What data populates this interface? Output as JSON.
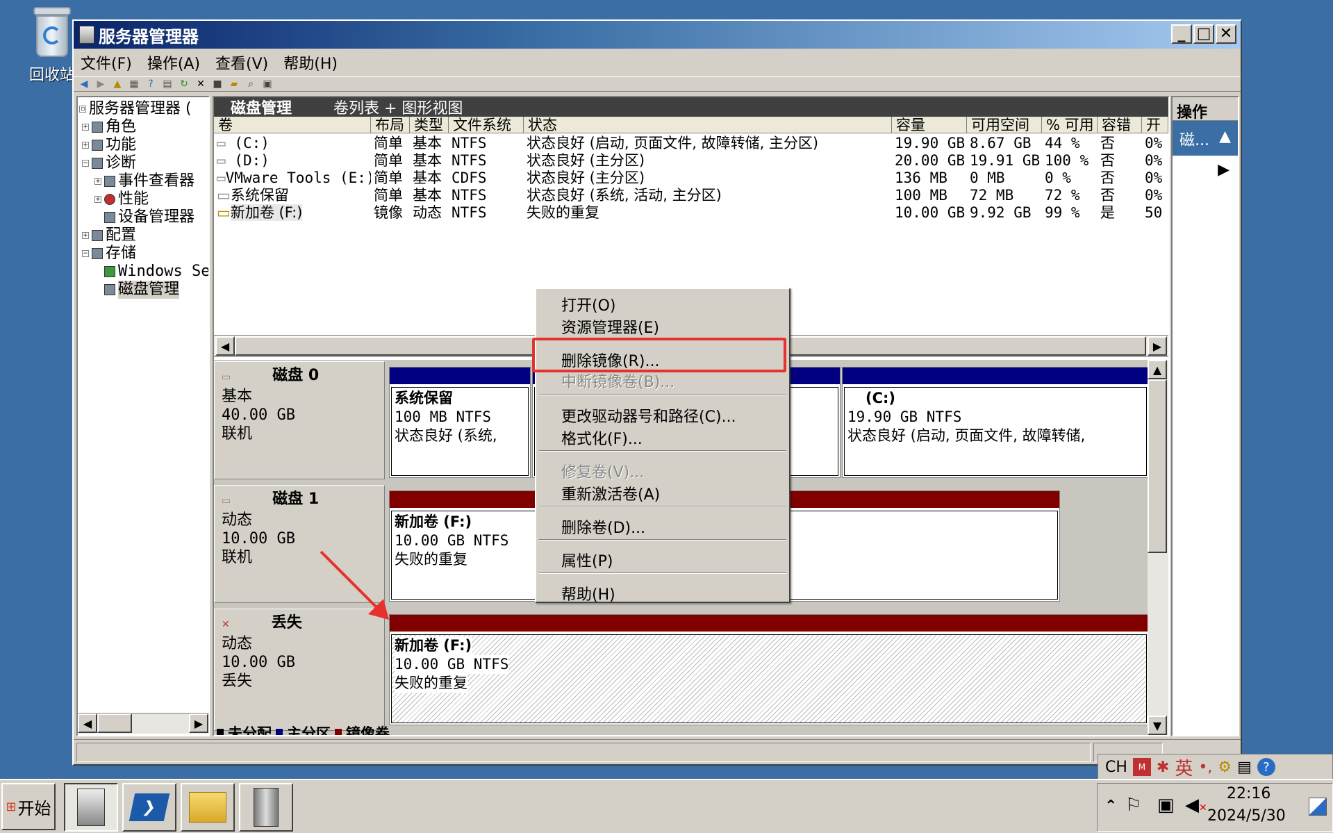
{
  "desktop": {
    "recycle_bin_label": "回收站"
  },
  "window": {
    "title": "服务器管理器",
    "controls": {
      "minimize": "_",
      "maximize": "□",
      "close": "✕"
    },
    "menu": [
      "文件(F)",
      "操作(A)",
      "查看(V)",
      "帮助(H)"
    ]
  },
  "tree": {
    "items": [
      {
        "label": "服务器管理器 (",
        "level": 0
      },
      {
        "label": "角色",
        "level": 1
      },
      {
        "label": "功能",
        "level": 1
      },
      {
        "label": "诊断",
        "level": 1
      },
      {
        "label": "事件查看器",
        "level": 2
      },
      {
        "label": "性能",
        "level": 2
      },
      {
        "label": "设备管理器",
        "level": 2
      },
      {
        "label": "配置",
        "level": 1
      },
      {
        "label": "存储",
        "level": 1
      },
      {
        "label": "Windows Ser",
        "level": 2
      },
      {
        "label": "磁盘管理",
        "level": 2
      }
    ]
  },
  "center": {
    "title": "磁盘管理",
    "view": "卷列表 + 图形视图",
    "columns": [
      "卷",
      "布局",
      "类型",
      "文件系统",
      "状态",
      "容量",
      "可用空间",
      "% 可用",
      "容错",
      "开"
    ],
    "rows": [
      [
        "(C:)",
        "简单",
        "基本",
        "NTFS",
        "状态良好 (启动, 页面文件, 故障转储, 主分区)",
        "19.90 GB",
        "8.67 GB",
        "44 %",
        "否",
        "0%"
      ],
      [
        "(D:)",
        "简单",
        "基本",
        "NTFS",
        "状态良好 (主分区)",
        "20.00 GB",
        "19.91 GB",
        "100 %",
        "否",
        "0%"
      ],
      [
        "VMware Tools (E:)",
        "简单",
        "基本",
        "CDFS",
        "状态良好 (主分区)",
        "136 MB",
        "0 MB",
        "0 %",
        "否",
        "0%"
      ],
      [
        "系统保留",
        "简单",
        "基本",
        "NTFS",
        "状态良好 (系统, 活动, 主分区)",
        "100 MB",
        "72 MB",
        "72 %",
        "否",
        "0%"
      ],
      [
        "新加卷 (F:)",
        "镜像",
        "动态",
        "NTFS",
        "失败的重复",
        "10.00 GB",
        "9.92 GB",
        "99 %",
        "是",
        "50"
      ]
    ],
    "disks": [
      {
        "name": "磁盘 0",
        "type": "基本",
        "size": "40.00 GB",
        "state": "联机"
      },
      {
        "name": "磁盘 1",
        "type": "动态",
        "size": "10.00 GB",
        "state": "联机"
      },
      {
        "name": "丢失",
        "type": "动态",
        "size": "10.00 GB",
        "state": "丢失"
      }
    ],
    "volumes": {
      "sysres": {
        "name": "系统保留",
        "fs": "100 MB NTFS",
        "status": "状态良好 (系统,"
      },
      "c": {
        "name": "(C:)",
        "fs": "19.90 GB NTFS",
        "status": "状态良好 (启动, 页面文件, 故障转储,"
      },
      "f1": {
        "name": "新加卷  (F:)",
        "fs": "10.00 GB NTFS",
        "status": "失败的重复"
      },
      "f2": {
        "name": "新加卷  (F:)",
        "fs": "10.00 GB NTFS",
        "status": "失败的重复"
      }
    },
    "legend": [
      "未分配",
      "主分区",
      "镜像卷"
    ]
  },
  "actions": {
    "header": "操作",
    "selected": "磁..."
  },
  "context_menu": {
    "items": [
      {
        "label": "打开(O)",
        "disabled": false
      },
      {
        "label": "资源管理器(E)",
        "disabled": false
      },
      {
        "label": "删除镜像(R)...",
        "disabled": false
      },
      {
        "label": "中断镜像卷(B)...",
        "disabled": true
      },
      {
        "label": "更改驱动器号和路径(C)...",
        "disabled": false
      },
      {
        "label": "格式化(F)...",
        "disabled": false
      },
      {
        "label": "修复卷(V)...",
        "disabled": true
      },
      {
        "label": "重新激活卷(A)",
        "disabled": false
      },
      {
        "label": "删除卷(D)...",
        "disabled": false
      },
      {
        "label": "属性(P)",
        "disabled": false
      },
      {
        "label": "帮助(H)",
        "disabled": false
      }
    ]
  },
  "taskbar": {
    "start": "开始",
    "lang": "CH",
    "ime": "英",
    "time": "22:16",
    "date": "2024/5/30"
  },
  "colors": {
    "primary_bar": "#000080",
    "mirror_bar": "#800000",
    "highlight": "#e5322d"
  }
}
